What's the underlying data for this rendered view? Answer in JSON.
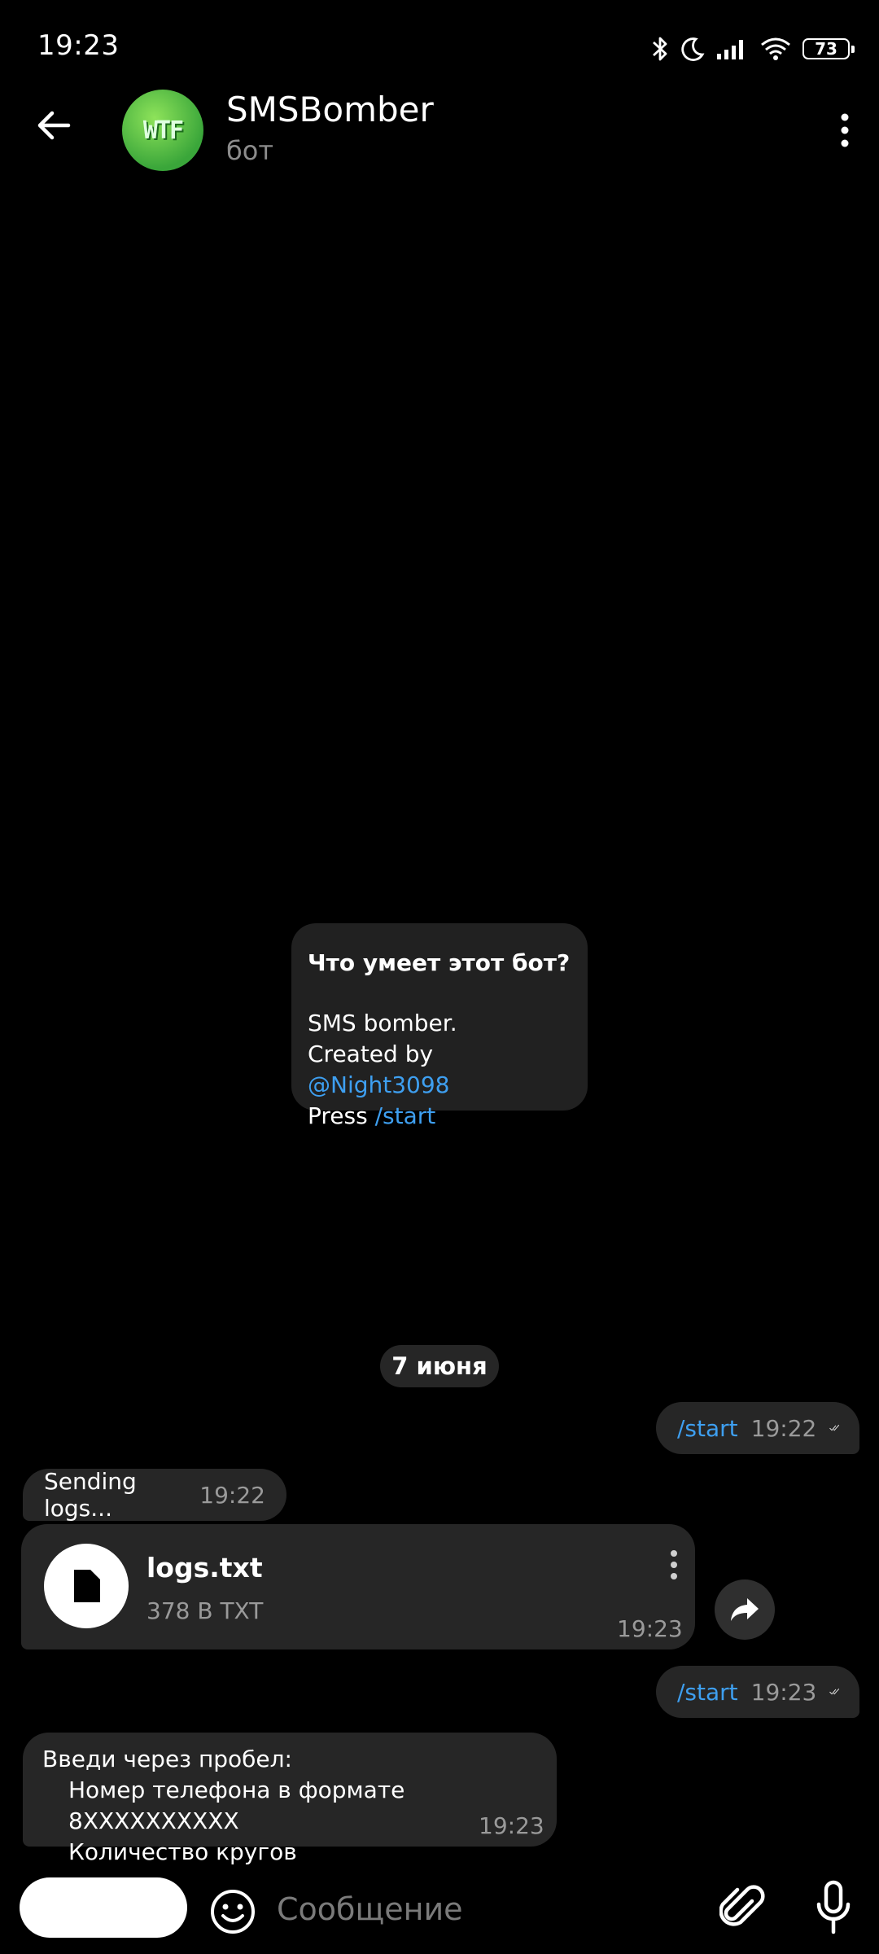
{
  "status_bar": {
    "time": "19:23",
    "battery": "73",
    "icons": [
      "bluetooth-icon",
      "moon-icon",
      "signal-icon",
      "wifi-icon",
      "battery-icon"
    ]
  },
  "header": {
    "title": "SMSBomber",
    "subtitle": "бот",
    "avatar_text": "WTF"
  },
  "intro": {
    "question": "Что умеет этот бот?",
    "line1": "SMS bomber.",
    "line2_prefix": "Created by ",
    "line2_link": "@Night3098",
    "line3_prefix": "Press ",
    "line3_link": "/start"
  },
  "date_chip": "7 июня",
  "messages": [
    {
      "dir": "out",
      "text": "/start",
      "time": "19:22"
    },
    {
      "dir": "in",
      "text": "Sending logs...",
      "time": "19:22"
    },
    {
      "dir": "in",
      "type": "file",
      "filename": "logs.txt",
      "meta": "378 B TXT",
      "time": "19:23"
    },
    {
      "dir": "out",
      "text": "/start",
      "time": "19:23"
    },
    {
      "dir": "in",
      "lines": [
        "Введи через пробел:",
        "Номер телефона в формате 8XXXXXXXXXX",
        "Количество кругов"
      ],
      "time": "19:23"
    }
  ],
  "composer": {
    "placeholder": "Сообщение"
  },
  "colors": {
    "background": "#000000",
    "bubble": "#262626",
    "link": "#3e9ff0",
    "avatar": "#5cc83f"
  }
}
